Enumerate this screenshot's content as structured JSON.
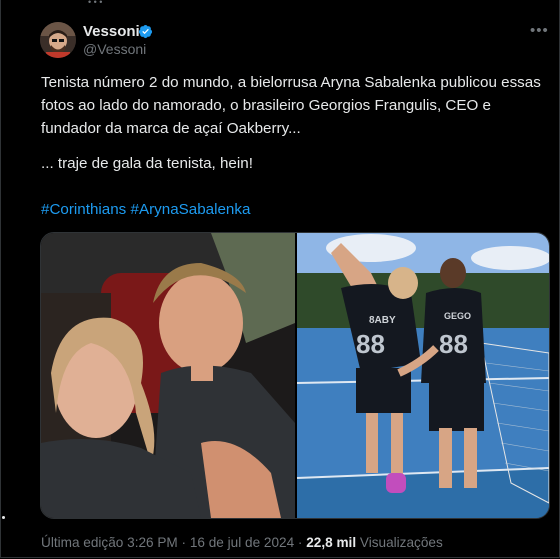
{
  "tweet": {
    "author_name": "Vessoni",
    "author_handle": "@Vessoni",
    "more_label": "•••",
    "text": "Tenista número 2 do mundo, a bielorrusa Aryna Sabalenka publicou essas fotos ao lado do namorado, o brasileiro Georgios Frangulis, CEO e fundador da marca de açaí Oakberry...",
    "text2": "... traje de gala da tenista, hein!",
    "hashtags": [
      "#Corinthians",
      "#ArynaSabalenka"
    ],
    "jersey_left": "8ABY",
    "jersey_left_number": "88",
    "jersey_right": "GEGO",
    "jersey_right_number": "88",
    "meta_prefix": "Última edição 3:26 PM · 16 de jul de 2024 · ",
    "views_count": "22,8 mil",
    "views_label": " Visualizações"
  },
  "colors": {
    "accent": "#1d9bf0",
    "background": "#000000",
    "muted": "#71767b"
  }
}
